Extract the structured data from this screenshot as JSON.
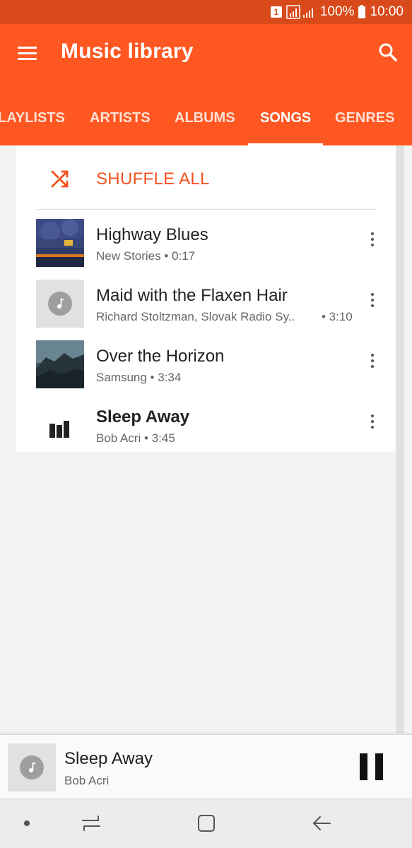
{
  "status_bar": {
    "sim": "1",
    "battery": "100%",
    "time": "10:00"
  },
  "app_bar": {
    "title": "Music library",
    "tabs": [
      {
        "label": "LAYLISTS"
      },
      {
        "label": "ARTISTS"
      },
      {
        "label": "ALBUMS"
      },
      {
        "label": "SONGS",
        "active": true
      },
      {
        "label": "GENRES"
      }
    ]
  },
  "list": {
    "shuffle_label": "SHUFFLE ALL",
    "songs": [
      {
        "title": "Highway Blues",
        "subtitle": "New Stories • 0:17"
      },
      {
        "title": "Maid with the Flaxen Hair",
        "subtitle": "Richard Stoltzman, Slovak Radio Sy..",
        "duration": "• 3:10"
      },
      {
        "title": "Over the Horizon",
        "subtitle": "Samsung • 3:34"
      },
      {
        "title": "Sleep Away",
        "subtitle": "Bob Acri • 3:45",
        "now_playing": true
      }
    ]
  },
  "player": {
    "title": "Sleep Away",
    "artist": "Bob Acri"
  },
  "colors": {
    "status_bar": "#d84a19",
    "app_bar": "#ff5722",
    "accent": "#f4511e"
  }
}
